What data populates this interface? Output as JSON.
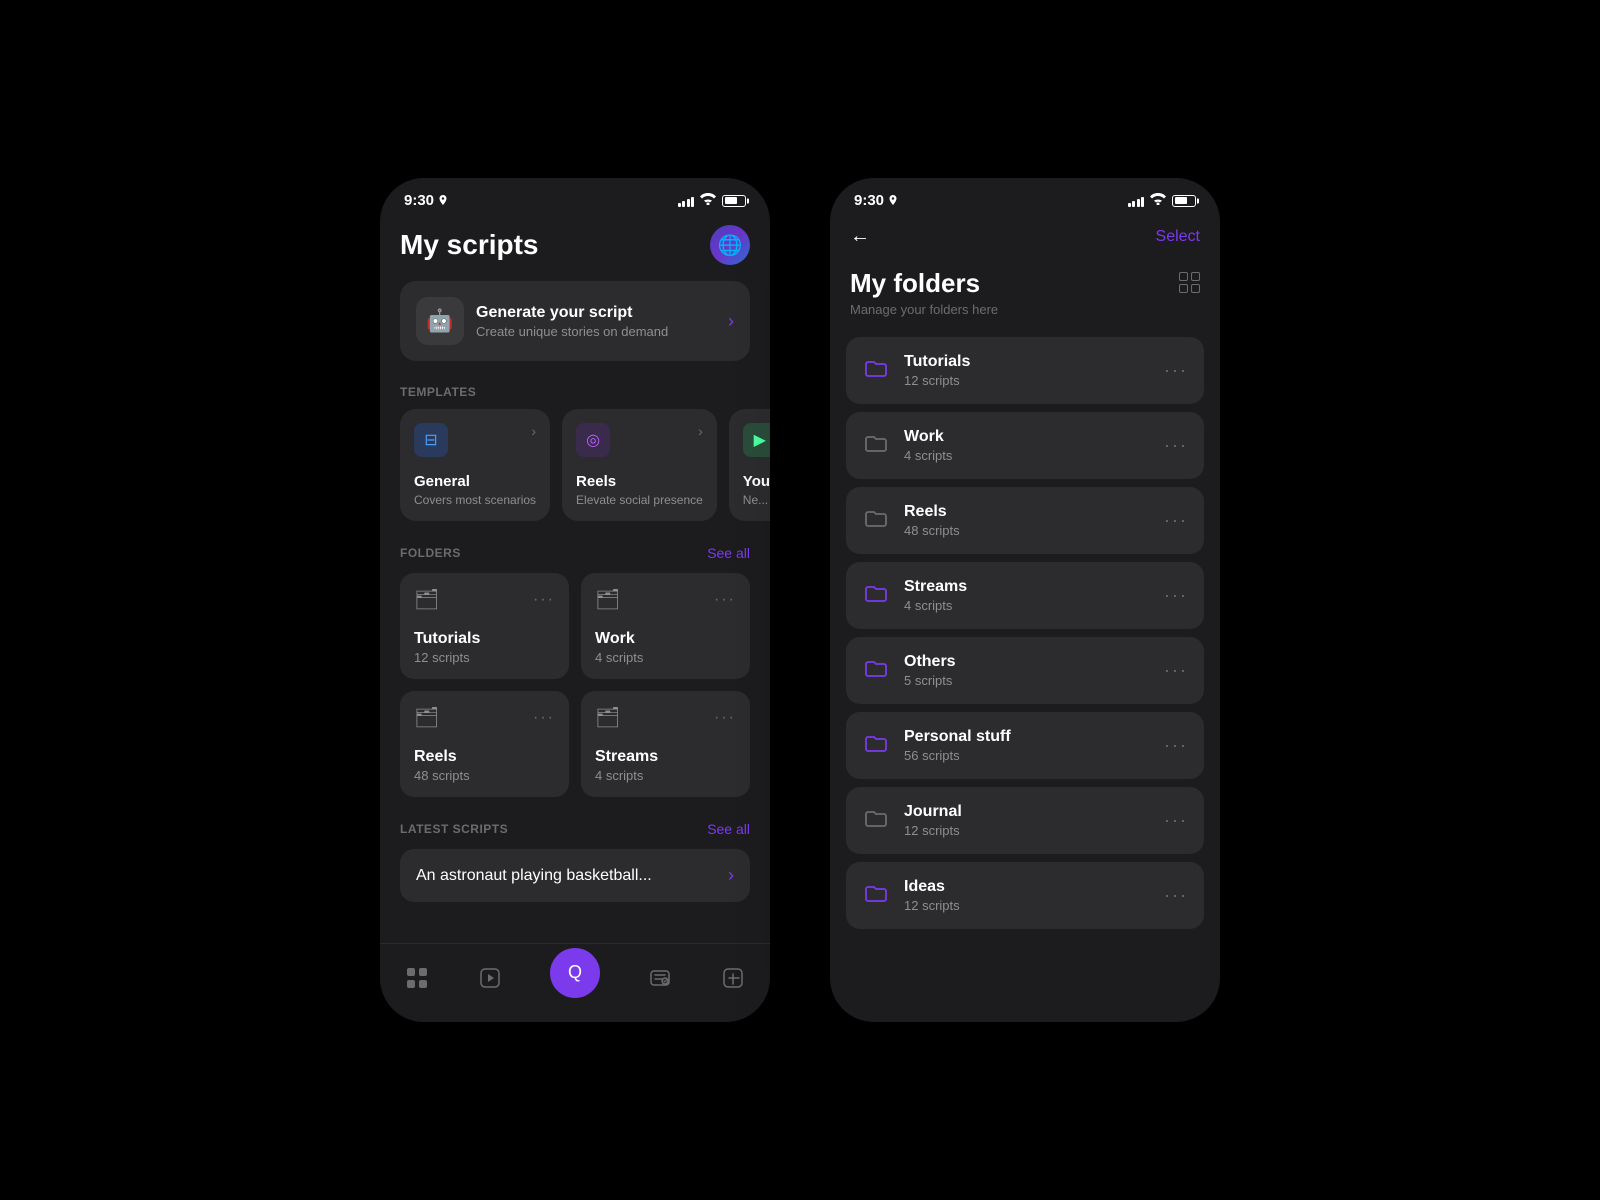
{
  "phone1": {
    "statusBar": {
      "time": "9:30",
      "locationIcon": "▶"
    },
    "header": {
      "title": "My scripts"
    },
    "generateCard": {
      "title": "Generate your script",
      "subtitle": "Create unique stories on demand"
    },
    "templatesLabel": "TEMPLATES",
    "templates": [
      {
        "name": "General",
        "desc": "Covers most scenarios",
        "icon": "⊟",
        "type": "general"
      },
      {
        "name": "Reels",
        "desc": "Elevate social presence",
        "icon": "◎",
        "type": "reels"
      },
      {
        "name": "You...",
        "desc": "Ne...",
        "icon": "▶",
        "type": "youtube"
      }
    ],
    "foldersLabel": "FOLDERS",
    "seeAllLabel": "See all",
    "folders": [
      {
        "name": "Tutorials",
        "count": "12 scripts"
      },
      {
        "name": "Work",
        "count": "4 scripts"
      },
      {
        "name": "Reels",
        "count": "48 scripts"
      },
      {
        "name": "Streams",
        "count": "4 scripts"
      }
    ],
    "latestLabel": "LATEST SCRIPTS",
    "latestSeeAll": "See all",
    "latestScript": "An astronaut playing basketball...",
    "nav": [
      {
        "label": "grid",
        "active": false
      },
      {
        "label": "play",
        "active": false
      },
      {
        "label": "add",
        "active": true,
        "center": true
      },
      {
        "label": "edit",
        "active": false
      },
      {
        "label": "plus",
        "active": false
      }
    ]
  },
  "phone2": {
    "statusBar": {
      "time": "9:30"
    },
    "header": {
      "selectLabel": "Select",
      "backIcon": "←"
    },
    "title": "My folders",
    "subtitle": "Manage your folders here",
    "folders": [
      {
        "name": "Tutorials",
        "count": "12 scripts",
        "iconColor": "purple"
      },
      {
        "name": "Work",
        "count": "4 scripts",
        "iconColor": "gray"
      },
      {
        "name": "Reels",
        "count": "48 scripts",
        "iconColor": "gray"
      },
      {
        "name": "Streams",
        "count": "4 scripts",
        "iconColor": "purple"
      },
      {
        "name": "Others",
        "count": "5 scripts",
        "iconColor": "purple"
      },
      {
        "name": "Personal stuff",
        "count": "56 scripts",
        "iconColor": "purple"
      },
      {
        "name": "Journal",
        "count": "12 scripts",
        "iconColor": "gray"
      },
      {
        "name": "Ideas",
        "count": "12 scripts",
        "iconColor": "purple"
      }
    ],
    "menuDots": "···"
  }
}
